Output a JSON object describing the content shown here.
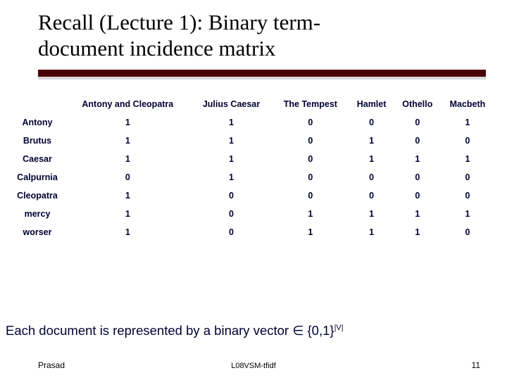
{
  "title_line1": "Recall (Lecture 1): Binary term-",
  "title_line2": "document incidence matrix",
  "columns": [
    "Antony and Cleopatra",
    "Julius Caesar",
    "The Tempest",
    "Hamlet",
    "Othello",
    "Macbeth"
  ],
  "rows": [
    {
      "term": "Antony",
      "v": [
        1,
        1,
        0,
        0,
        0,
        1
      ]
    },
    {
      "term": "Brutus",
      "v": [
        1,
        1,
        0,
        1,
        0,
        0
      ]
    },
    {
      "term": "Caesar",
      "v": [
        1,
        1,
        0,
        1,
        1,
        1
      ]
    },
    {
      "term": "Calpurnia",
      "v": [
        0,
        1,
        0,
        0,
        0,
        0
      ]
    },
    {
      "term": "Cleopatra",
      "v": [
        1,
        0,
        0,
        0,
        0,
        0
      ]
    },
    {
      "term": "mercy",
      "v": [
        1,
        0,
        1,
        1,
        1,
        1
      ]
    },
    {
      "term": "worser",
      "v": [
        1,
        0,
        1,
        1,
        1,
        0
      ]
    }
  ],
  "caption_prefix": "Each document is represented by a binary vector ",
  "caption_in": "∈",
  "caption_set": " {0,1}",
  "caption_exp": "|V|",
  "footer": {
    "author": "Prasad",
    "code": "L08VSM-tfidf",
    "page": "11"
  },
  "chart_data": {
    "type": "table",
    "title": "Binary term-document incidence matrix",
    "columns": [
      "Antony and Cleopatra",
      "Julius Caesar",
      "The Tempest",
      "Hamlet",
      "Othello",
      "Macbeth"
    ],
    "row_labels": [
      "Antony",
      "Brutus",
      "Caesar",
      "Calpurnia",
      "Cleopatra",
      "mercy",
      "worser"
    ],
    "values": [
      [
        1,
        1,
        0,
        0,
        0,
        1
      ],
      [
        1,
        1,
        0,
        1,
        0,
        0
      ],
      [
        1,
        1,
        0,
        1,
        1,
        1
      ],
      [
        0,
        1,
        0,
        0,
        0,
        0
      ],
      [
        1,
        0,
        0,
        0,
        0,
        0
      ],
      [
        1,
        0,
        1,
        1,
        1,
        1
      ],
      [
        1,
        0,
        1,
        1,
        1,
        0
      ]
    ]
  }
}
